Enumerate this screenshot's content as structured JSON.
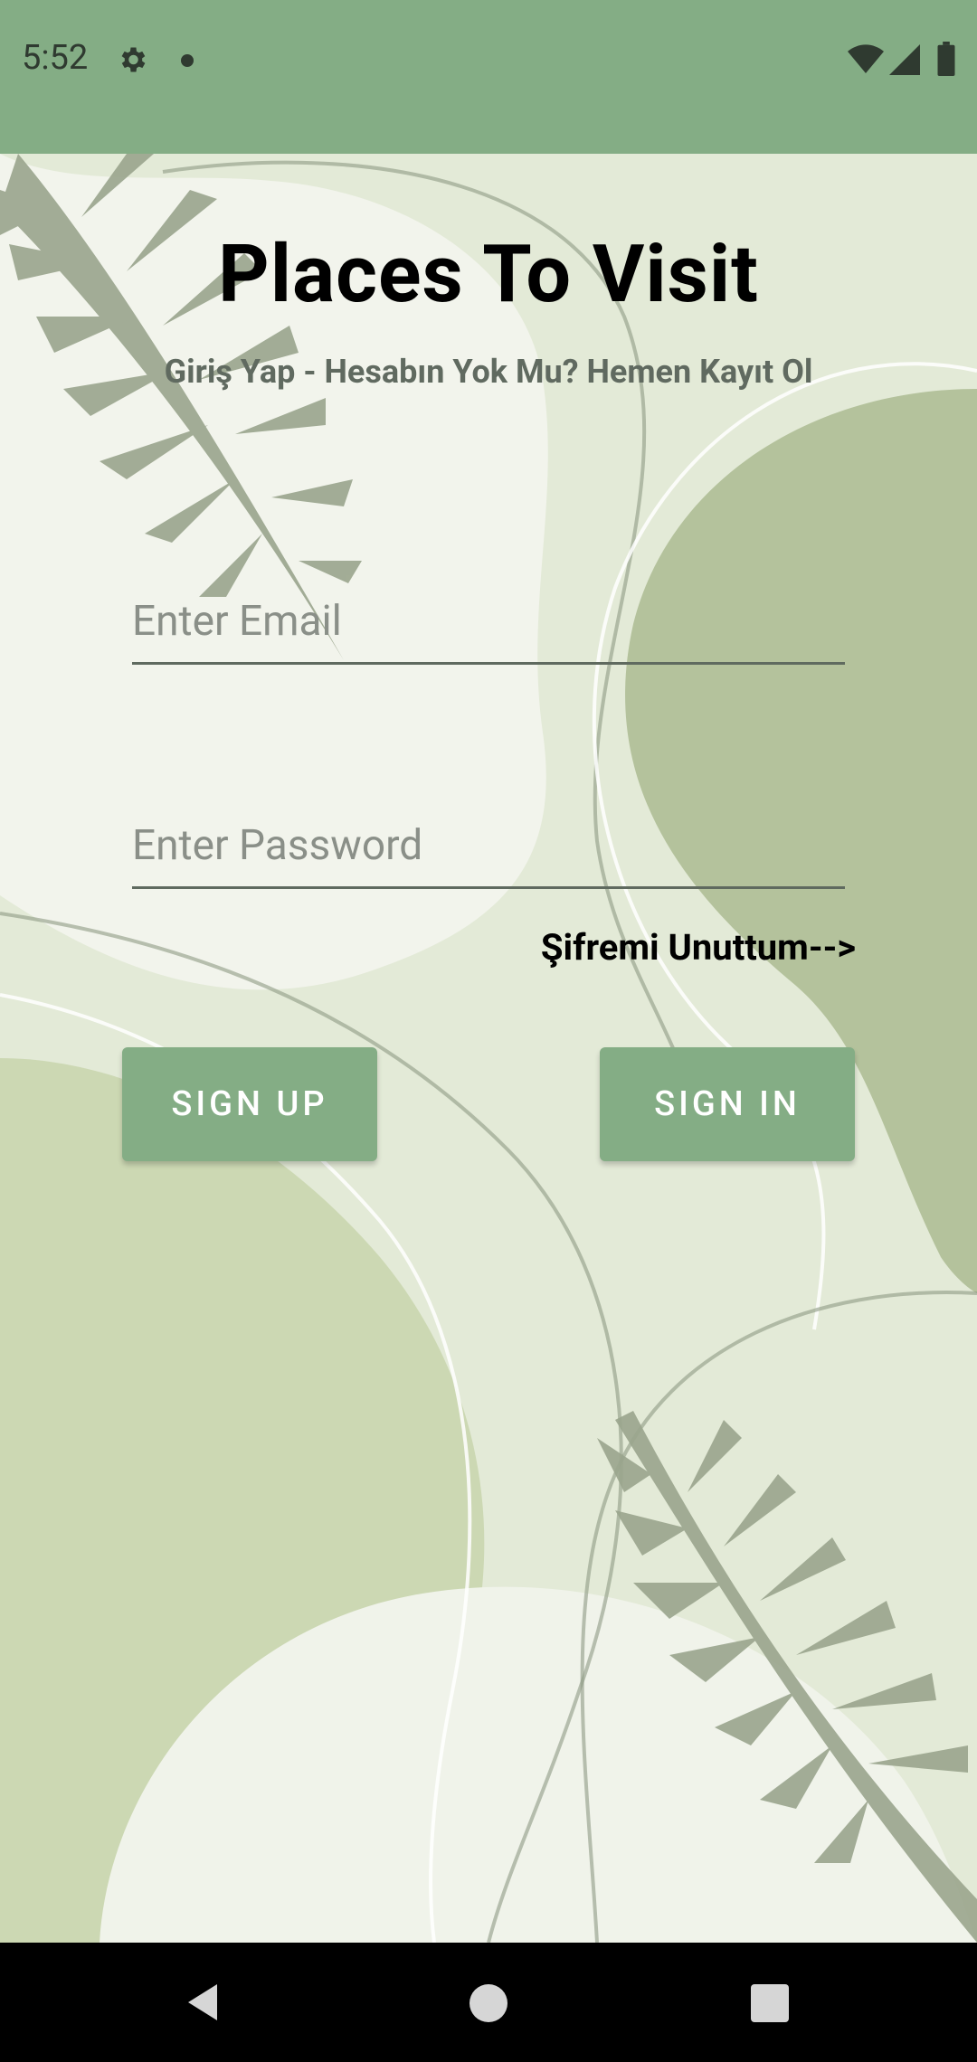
{
  "status_bar": {
    "time": "5:52",
    "icons": [
      "gear-icon",
      "dot-icon",
      "wifi-icon",
      "signal-icon",
      "battery-icon"
    ]
  },
  "screen": {
    "title": "Places To Visit",
    "subtitle": "Giriş Yap - Hesabın Yok Mu? Hemen Kayıt Ol"
  },
  "form": {
    "email_placeholder": "Enter Email",
    "email_value": "",
    "password_placeholder": "Enter Password",
    "password_value": "",
    "forgot_label": "Şifremi Unuttum-->"
  },
  "actions": {
    "signup_label": "SIGN UP",
    "signin_label": "SIGN IN"
  },
  "nav_bar": {
    "icons": [
      "back-icon",
      "home-icon",
      "recents-icon"
    ]
  },
  "colors": {
    "accent": "#84ad85",
    "background": "#e3ead7",
    "leaf": "#9aa58d",
    "blob_dark": "#b4c29c",
    "blob_light": "#f2f4ec"
  }
}
